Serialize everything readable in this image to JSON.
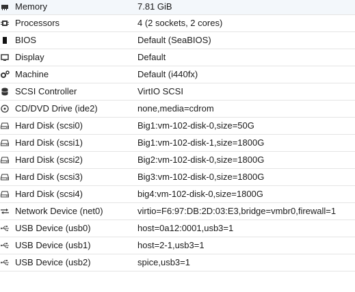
{
  "hardware": [
    {
      "key": "Memory",
      "value": "7.81 GiB",
      "icon": "memory-icon"
    },
    {
      "key": "Processors",
      "value": "4 (2 sockets, 2 cores)",
      "icon": "cpu-icon"
    },
    {
      "key": "BIOS",
      "value": "Default (SeaBIOS)",
      "icon": "chip-icon"
    },
    {
      "key": "Display",
      "value": "Default",
      "icon": "monitor-icon"
    },
    {
      "key": "Machine",
      "value": "Default (i440fx)",
      "icon": "cogs-icon"
    },
    {
      "key": "SCSI Controller",
      "value": "VirtIO SCSI",
      "icon": "database-icon"
    },
    {
      "key": "CD/DVD Drive (ide2)",
      "value": "none,media=cdrom",
      "icon": "cdrom-icon"
    },
    {
      "key": "Hard Disk (scsi0)",
      "value": "Big1:vm-102-disk-0,size=50G",
      "icon": "hdd-icon"
    },
    {
      "key": "Hard Disk (scsi1)",
      "value": "Big1:vm-102-disk-1,size=1800G",
      "icon": "hdd-icon"
    },
    {
      "key": "Hard Disk (scsi2)",
      "value": "Big2:vm-102-disk-0,size=1800G",
      "icon": "hdd-icon"
    },
    {
      "key": "Hard Disk (scsi3)",
      "value": "Big3:vm-102-disk-0,size=1800G",
      "icon": "hdd-icon"
    },
    {
      "key": "Hard Disk (scsi4)",
      "value": "big4:vm-102-disk-0,size=1800G",
      "icon": "hdd-icon"
    },
    {
      "key": "Network Device (net0)",
      "value": "virtio=F6:97:DB:2D:03:E3,bridge=vmbr0,firewall=1",
      "icon": "network-exchange-icon"
    },
    {
      "key": "USB Device (usb0)",
      "value": "host=0a12:0001,usb3=1",
      "icon": "usb-icon"
    },
    {
      "key": "USB Device (usb1)",
      "value": "host=2-1,usb3=1",
      "icon": "usb-icon"
    },
    {
      "key": "USB Device (usb2)",
      "value": "spice,usb3=1",
      "icon": "usb-icon"
    }
  ]
}
